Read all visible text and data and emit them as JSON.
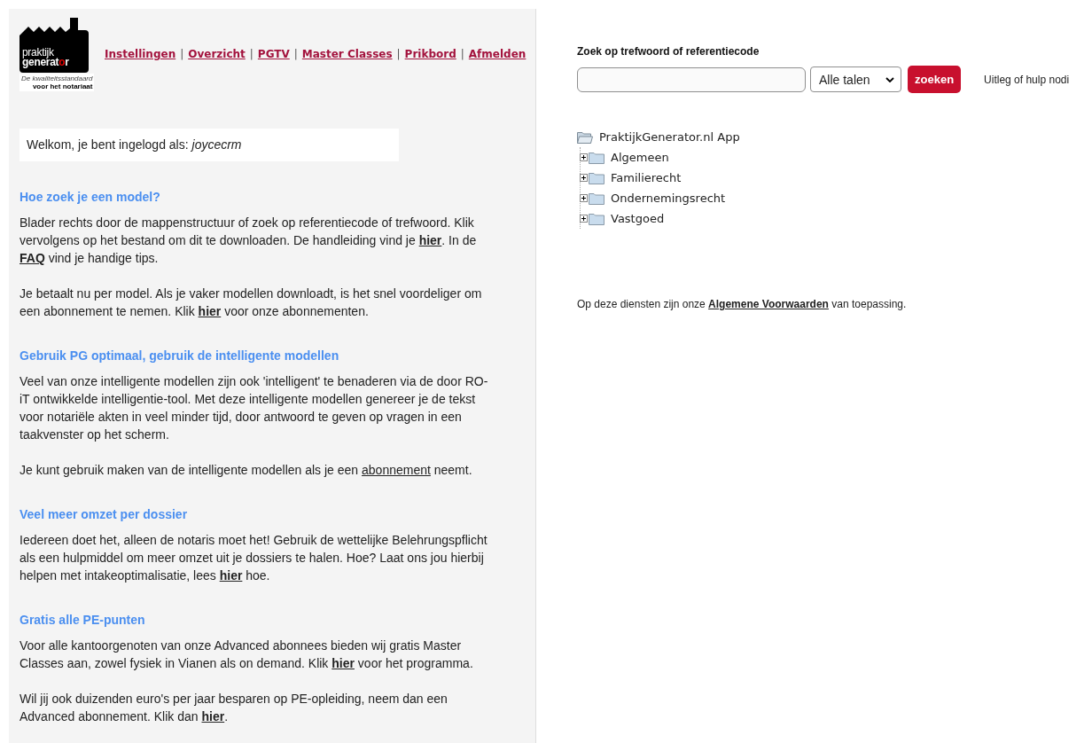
{
  "logo": {
    "name_line1": "praktijk",
    "name_line2": "generat",
    "name_dot_letter": "o",
    "name_end": "r",
    "tagline1": "De kwaliteitsstandaard",
    "tagline2": "voor het notariaat"
  },
  "nav": [
    "Instellingen",
    "Overzicht",
    "PGTV",
    "Master Classes",
    "Prikbord",
    "Afmelden"
  ],
  "nav_separator": "|",
  "welcome": {
    "text": "Welkom, je bent ingelogd als: ",
    "user": "joycecrm"
  },
  "sections": [
    {
      "heading": "Hoe zoek je een model?",
      "paragraphs": [
        [
          {
            "kind": "text",
            "text": "Blader rechts door de mappenstructuur of zoek op referentiecode of trefwoord. Klik vervolgens op het bestand om dit te downloaden. De handleiding vind je "
          },
          {
            "kind": "bold-link",
            "text": "hier"
          },
          {
            "kind": "text",
            "text": ". In de "
          },
          {
            "kind": "bold-link",
            "text": "FAQ"
          },
          {
            "kind": "text",
            "text": " vind je handige tips."
          }
        ],
        [
          {
            "kind": "text",
            "text": "Je betaalt nu per model. Als je vaker modellen downloadt, is het snel voordeliger om een abonnement te nemen. Klik "
          },
          {
            "kind": "bold-link",
            "text": "hier"
          },
          {
            "kind": "text",
            "text": " voor onze abonnementen."
          }
        ]
      ]
    },
    {
      "heading": "Gebruik PG optimaal, gebruik de intelligente modellen",
      "paragraphs": [
        [
          {
            "kind": "text",
            "text": "Veel van onze intelligente modellen zijn ook 'intelligent' te benaderen via de door RO-iT ontwikkelde intelligentie-tool. Met deze intelligente modellen genereer je de tekst voor notariële akten in veel minder tijd, door antwoord te geven op vragen in een taakvenster op het scherm."
          }
        ],
        [
          {
            "kind": "text",
            "text": "Je kunt gebruik maken van de intelligente modellen als je een "
          },
          {
            "kind": "link",
            "text": "abonnement"
          },
          {
            "kind": "text",
            "text": " neemt."
          }
        ]
      ]
    },
    {
      "heading": "Veel meer omzet per dossier",
      "paragraphs": [
        [
          {
            "kind": "text",
            "text": "Iedereen doet het, alleen de notaris moet het! Gebruik de wettelijke Belehrungspflicht als een hulpmiddel om meer omzet uit je dossiers te halen. Hoe? Laat ons jou hierbij helpen met intakeoptimalisatie, lees "
          },
          {
            "kind": "bold-link",
            "text": "hier"
          },
          {
            "kind": "text",
            "text": " hoe."
          }
        ]
      ]
    },
    {
      "heading": "Gratis alle PE-punten",
      "paragraphs": [
        [
          {
            "kind": "text",
            "text": "Voor alle kantoorgenoten van onze Advanced abonnees bieden wij gratis Master Classes aan, zowel fysiek in Vianen als on demand. Klik "
          },
          {
            "kind": "bold-link",
            "text": "hier"
          },
          {
            "kind": "text",
            "text": " voor het programma."
          }
        ],
        [
          {
            "kind": "text",
            "text": "Wil jij ook duizenden euro's per jaar besparen op PE-opleiding, neem dan een Advanced abonnement. Klik dan "
          },
          {
            "kind": "bold-link",
            "text": "hier"
          },
          {
            "kind": "text",
            "text": "."
          }
        ]
      ]
    }
  ],
  "search": {
    "label": "Zoek op trefwoord of referentiecode",
    "language": "Alle talen",
    "button": "zoeken",
    "help": "Uitleg of hulp nodi"
  },
  "tree": {
    "label": "PraktijkGenerator.nl App",
    "expanded": true,
    "children": [
      {
        "label": "Algemeen",
        "expanded": false
      },
      {
        "label": "Familierecht",
        "expanded": false
      },
      {
        "label": "Ondernemingsrecht",
        "expanded": false
      },
      {
        "label": "Vastgoed",
        "expanded": false
      }
    ]
  },
  "terms": [
    {
      "kind": "text",
      "text": "Op deze diensten zijn onze "
    },
    {
      "kind": "bold-link",
      "text": "Algemene Voorwaarden"
    },
    {
      "kind": "text",
      "text": " van toepassing."
    }
  ]
}
